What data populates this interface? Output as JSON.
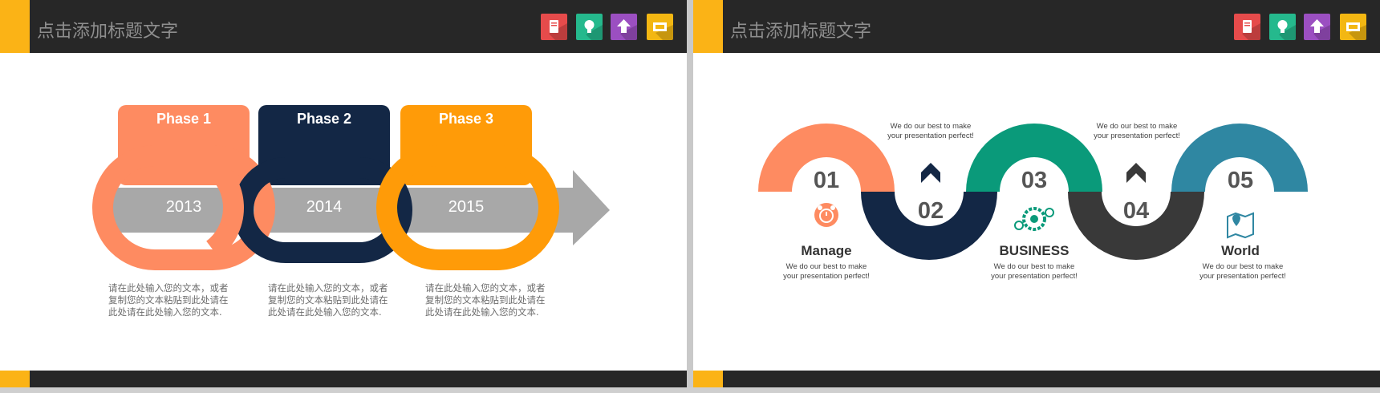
{
  "colors": {
    "accent": "#fbb316",
    "header_bg": "#272727",
    "salmon": "#fe8b61",
    "navy": "#132745",
    "orange": "#ff9b08",
    "teal_green": "#0a9a7a",
    "dark_gray": "#393939",
    "steel_blue": "#2f87a2",
    "arrow_gray": "#a8a8a8"
  },
  "header_icons": [
    {
      "icon": "book-icon",
      "color": "#e64b4b"
    },
    {
      "icon": "lightbulb-icon",
      "color": "#25b98d"
    },
    {
      "icon": "upload-arrow-icon",
      "color": "#9b4fc1"
    },
    {
      "icon": "monitor-icon",
      "color": "#f3b712"
    }
  ],
  "slide1": {
    "title": "点击添加标题文字",
    "phases": [
      {
        "label": "Phase 1",
        "year": "2013",
        "text": "请在此处输入您的文本，或者\n复制您的文本粘贴到此处请在\n此处请在此处输入您的文本."
      },
      {
        "label": "Phase 2",
        "year": "2014",
        "text": "请在此处输入您的文本，或者\n复制您的文本粘贴到此处请在\n此处请在此处输入您的文本."
      },
      {
        "label": "Phase 3",
        "year": "2015",
        "text": "请在此处输入您的文本，或者\n复制您的文本粘贴到此处请在\n此处请在此处输入您的文本."
      }
    ]
  },
  "slide2": {
    "title": "点击添加标题文字",
    "steps": [
      {
        "num": "01",
        "label": "Manage",
        "text1": "We do our best to make",
        "text2": "your presentation perfect!",
        "icon": "alarm-clock-icon"
      },
      {
        "num": "02",
        "icon": "chevron-up-icon",
        "text1": "We do our best to make",
        "text2": "your presentation perfect!"
      },
      {
        "num": "03",
        "label": "BUSINESS",
        "text1": "We do our best to make",
        "text2": "your presentation perfect!",
        "icon": "gears-icon"
      },
      {
        "num": "04",
        "icon": "chevron-up-icon",
        "text1": "We do our best to make",
        "text2": "your presentation perfect!"
      },
      {
        "num": "05",
        "label": "World",
        "text1": "We do our best to make",
        "text2": "your presentation perfect!",
        "icon": "map-pin-icon"
      }
    ]
  }
}
